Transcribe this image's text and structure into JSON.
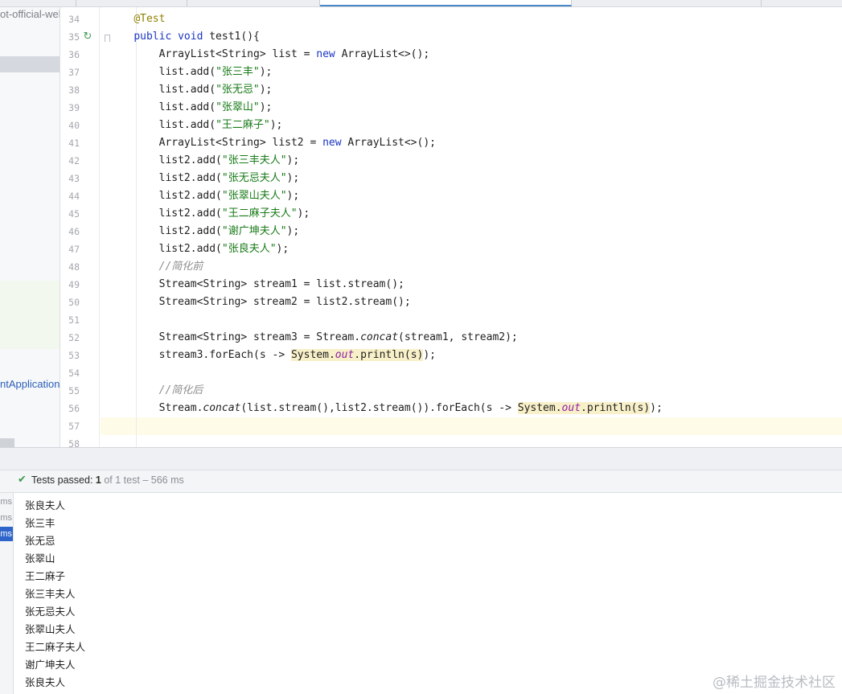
{
  "sidebar": {
    "project_name": "ot-official-wel",
    "app_class": "ntApplication"
  },
  "editor": {
    "line_numbers": [
      "34",
      "35",
      "36",
      "37",
      "38",
      "39",
      "40",
      "41",
      "42",
      "43",
      "44",
      "45",
      "46",
      "47",
      "48",
      "49",
      "50",
      "51",
      "52",
      "53",
      "54",
      "55",
      "56",
      "57",
      "58"
    ],
    "current_line": "57",
    "run_icon": "run-test-icon",
    "lines": [
      [
        {
          "t": "    "
        },
        {
          "t": "@Test",
          "c": "ann"
        }
      ],
      [
        {
          "t": "    "
        },
        {
          "t": "public void",
          "c": "kw"
        },
        {
          "t": " test1(){"
        }
      ],
      [
        {
          "t": "        ArrayList<String> list = "
        },
        {
          "t": "new",
          "c": "kw"
        },
        {
          "t": " ArrayList<>();"
        }
      ],
      [
        {
          "t": "        list.add("
        },
        {
          "t": "\"张三丰\"",
          "c": "str"
        },
        {
          "t": ");"
        }
      ],
      [
        {
          "t": "        list.add("
        },
        {
          "t": "\"张无忌\"",
          "c": "str"
        },
        {
          "t": ");"
        }
      ],
      [
        {
          "t": "        list.add("
        },
        {
          "t": "\"张翠山\"",
          "c": "str"
        },
        {
          "t": ");"
        }
      ],
      [
        {
          "t": "        list.add("
        },
        {
          "t": "\"王二麻子\"",
          "c": "str"
        },
        {
          "t": ");"
        }
      ],
      [
        {
          "t": "        ArrayList<String> list2 = "
        },
        {
          "t": "new",
          "c": "kw"
        },
        {
          "t": " ArrayList<>();"
        }
      ],
      [
        {
          "t": "        list2.add("
        },
        {
          "t": "\"张三丰夫人\"",
          "c": "str"
        },
        {
          "t": ");"
        }
      ],
      [
        {
          "t": "        list2.add("
        },
        {
          "t": "\"张无忌夫人\"",
          "c": "str"
        },
        {
          "t": ");"
        }
      ],
      [
        {
          "t": "        list2.add("
        },
        {
          "t": "\"张翠山夫人\"",
          "c": "str"
        },
        {
          "t": ");"
        }
      ],
      [
        {
          "t": "        list2.add("
        },
        {
          "t": "\"王二麻子夫人\"",
          "c": "str"
        },
        {
          "t": ");"
        }
      ],
      [
        {
          "t": "        list2.add("
        },
        {
          "t": "\"谢广坤夫人\"",
          "c": "str"
        },
        {
          "t": ");"
        }
      ],
      [
        {
          "t": "        list2.add("
        },
        {
          "t": "\"张良夫人\"",
          "c": "str"
        },
        {
          "t": ");"
        }
      ],
      [
        {
          "t": "        "
        },
        {
          "t": "//简化前",
          "c": "cmt"
        }
      ],
      [
        {
          "t": "        Stream<String> stream1 = list.stream();"
        }
      ],
      [
        {
          "t": "        Stream<String> stream2 = list2.stream();"
        }
      ],
      [
        {
          "t": ""
        }
      ],
      [
        {
          "t": "        Stream<String> stream3 = Stream."
        },
        {
          "t": "concat",
          "c": "ital"
        },
        {
          "t": "(stream1, stream2);"
        }
      ],
      [
        {
          "t": "        stream3.forEach(s -> "
        },
        {
          "t": "System.",
          "c": "hl"
        },
        {
          "t": "out",
          "c": "fld hl"
        },
        {
          "t": ".println(s)",
          "c": "hl"
        },
        {
          "t": ");"
        }
      ],
      [
        {
          "t": ""
        }
      ],
      [
        {
          "t": "        "
        },
        {
          "t": "//简化后",
          "c": "cmt"
        }
      ],
      [
        {
          "t": "        Stream."
        },
        {
          "t": "concat",
          "c": "ital"
        },
        {
          "t": "(list.stream(),list2.stream()).forEach(s -> "
        },
        {
          "t": "System.",
          "c": "hl"
        },
        {
          "t": "out",
          "c": "fld hl"
        },
        {
          "t": ".println(s)",
          "c": "hl"
        },
        {
          "t": ");"
        }
      ],
      [
        {
          "t": ""
        }
      ],
      [
        {
          "t": ""
        }
      ]
    ]
  },
  "run_panel": {
    "status_icon": "check-icon",
    "status_label": "Tests passed:",
    "passed_count": "1",
    "of_total": "of 1 test",
    "separator": "–",
    "duration": "566 ms",
    "tree_durations": [
      "ms",
      "ms",
      "ms"
    ],
    "output": [
      "张良夫人",
      "张三丰",
      "张无忌",
      "张翠山",
      "王二麻子",
      "张三丰夫人",
      "张无忌夫人",
      "张翠山夫人",
      "王二麻子夫人",
      "谢广坤夫人",
      "张良夫人"
    ]
  },
  "watermark": "@稀土掘金技术社区"
}
